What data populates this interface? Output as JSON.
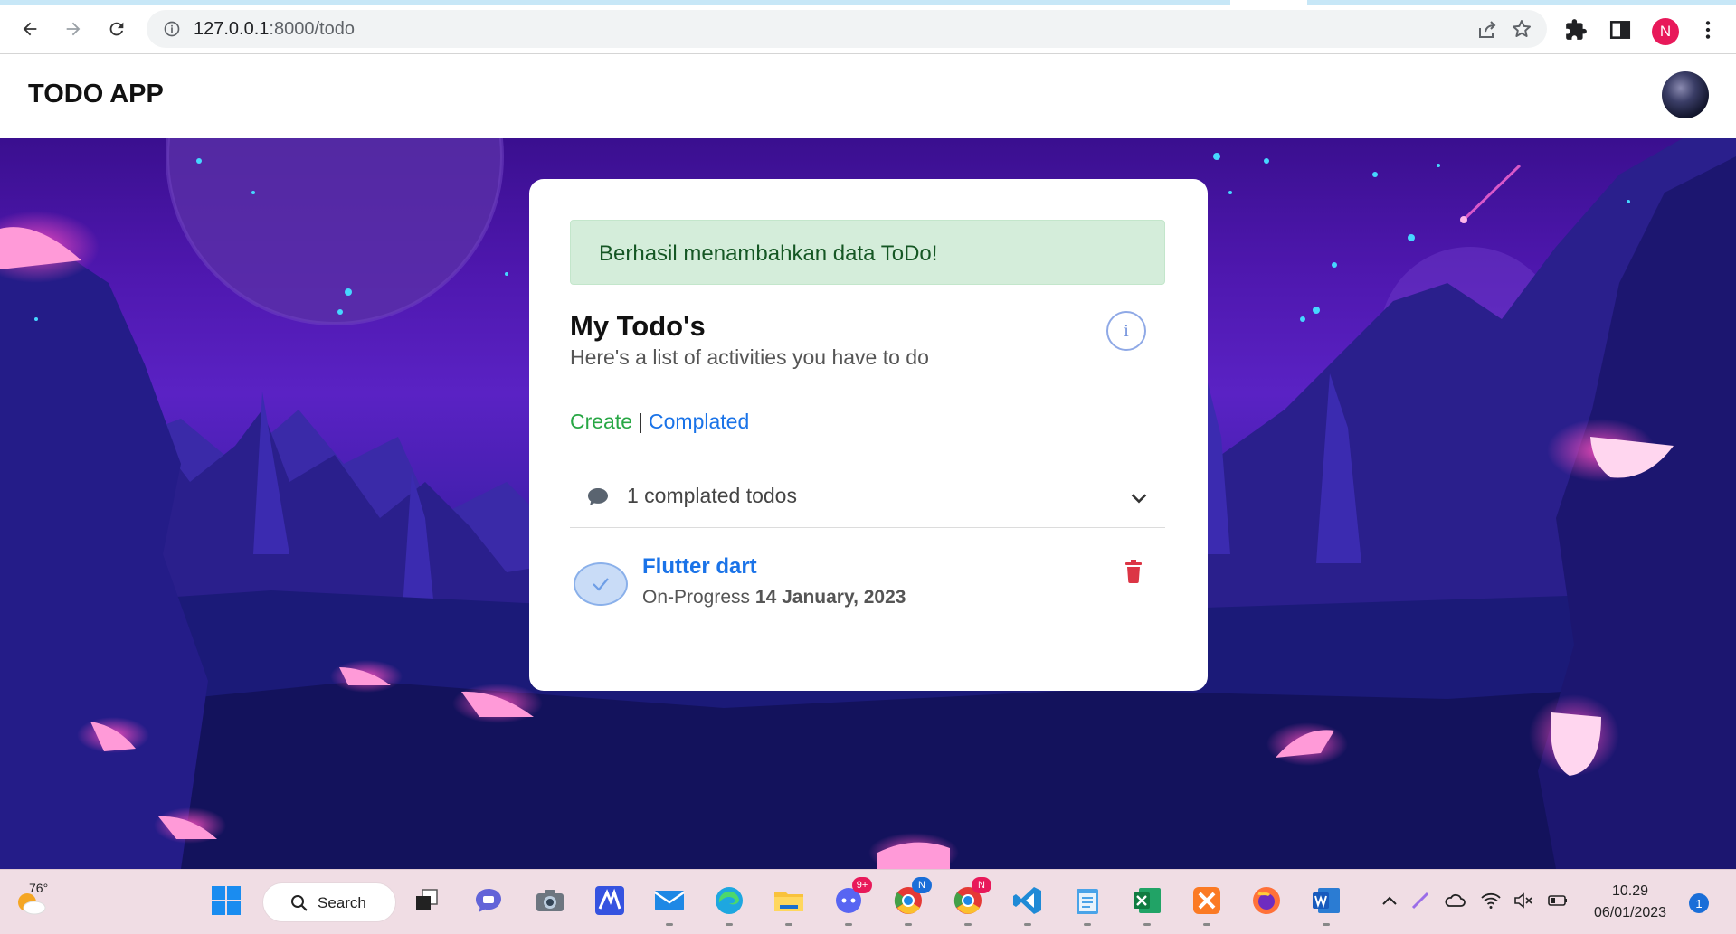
{
  "browser": {
    "url_host": "127.0.0.1",
    "url_path": ":8000/todo",
    "profile_initial": "N",
    "icons": [
      "back-arrow-icon",
      "forward-arrow-icon",
      "reload-icon",
      "site-info-icon",
      "share-icon",
      "bookmark-star-icon",
      "extensions-icon",
      "side-panel-icon",
      "menu-kebab-icon"
    ]
  },
  "app": {
    "title": "TODO APP"
  },
  "card": {
    "alert_text": "Berhasil menambahkan data ToDo!",
    "title": "My Todo's",
    "subtitle": "Here's a list of activities you have to do",
    "info_symbol": "i",
    "link_create": "Create",
    "link_separator": "|",
    "link_completed": "Complated",
    "accordion_label": "1 complated todos",
    "todos": [
      {
        "title": "Flutter dart",
        "status": "On-Progress",
        "date": "14 January, 2023"
      }
    ]
  },
  "taskbar": {
    "weather_temp": "76°",
    "search_label": "Search",
    "discord_badge": "9+",
    "chrome_badge_1": "N",
    "chrome_badge_2": "N",
    "time": "10.29",
    "date": "06/01/2023",
    "notification_count": "1"
  },
  "colors": {
    "alert_bg": "#d4edda",
    "alert_text": "#155724",
    "create_link": "#28a745",
    "link_blue": "#1a73e8",
    "delete_red": "#dc3545",
    "profile_pink": "#e8195a"
  }
}
